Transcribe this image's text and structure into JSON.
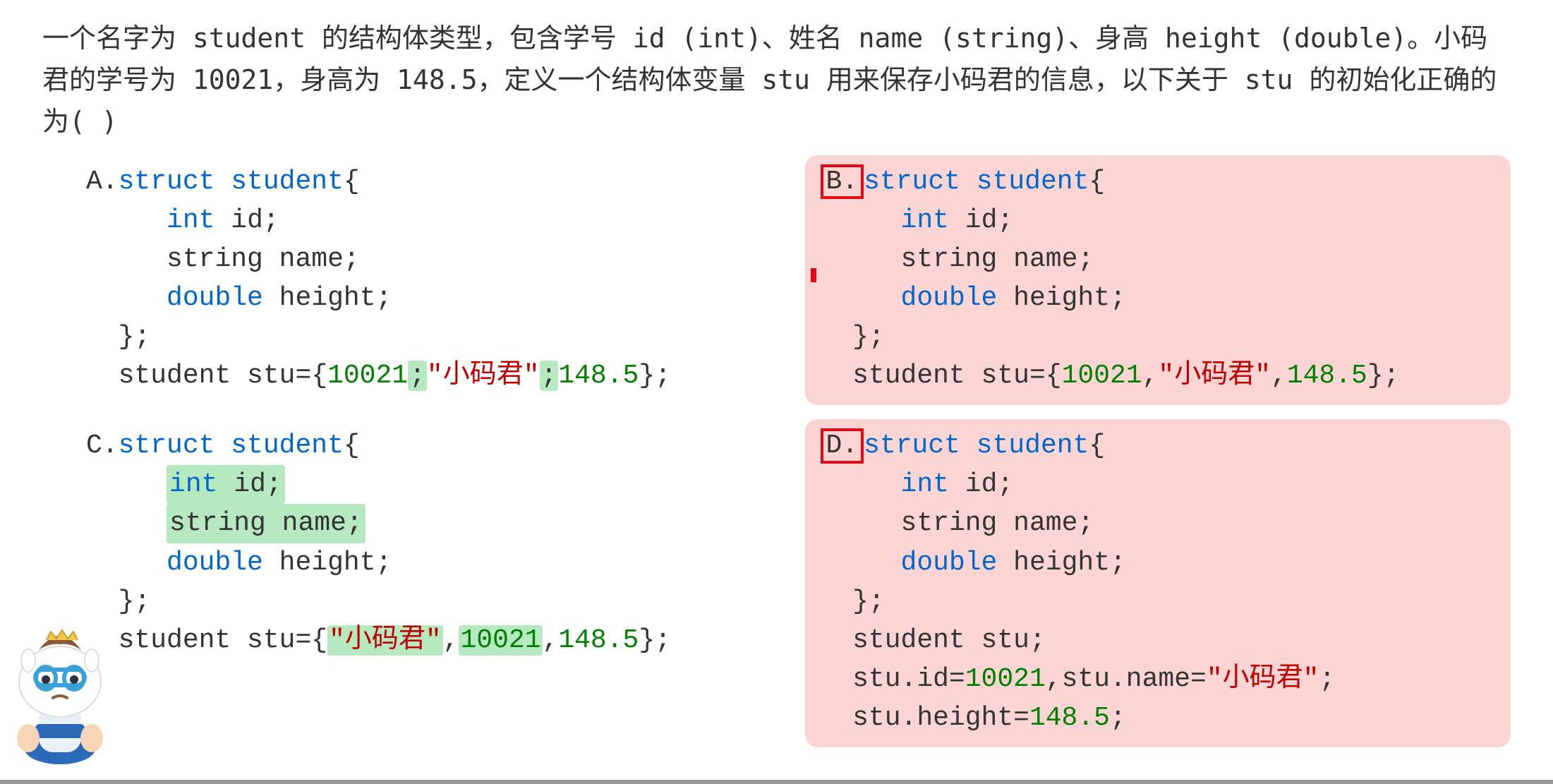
{
  "question": {
    "stem": "一个名字为 student 的结构体类型，包含学号 id (int)、姓名 name (string)、身高 height (double)。小码君的学号为 10021，身高为 148.5，定义一个结构体变量 stu 用来保存小码君的信息，以下关于 stu 的初始化正确的为(   )"
  },
  "options": {
    "A": {
      "label": "A.",
      "struct_kw": "struct",
      "struct_name": "student",
      "brace_open": "{",
      "line_int": "int",
      "id_name": "id;",
      "line_string": "string name;",
      "line_double": "double",
      "height_name": "height;",
      "brace_close": "};",
      "init_prefix": "student stu={",
      "init_num1": "10021",
      "init_sep1": ";",
      "init_str": "\"小码君\"",
      "init_sep2": ";",
      "init_num2": "148.5",
      "init_suffix": "};"
    },
    "B": {
      "label": "B.",
      "struct_kw": "struct",
      "struct_name": "student",
      "brace_open": "{",
      "line_int": "int",
      "id_name": "id;",
      "line_string": "string name;",
      "line_double": "double",
      "height_name": "height;",
      "brace_close": "};",
      "init_prefix": "student stu={",
      "init_num1": "10021",
      "init_sep1": ",",
      "init_str": "\"小码君\"",
      "init_sep2": ",",
      "init_num2": "148.5",
      "init_suffix": "};"
    },
    "C": {
      "label": "C.",
      "struct_kw": "struct",
      "struct_name": "student",
      "brace_open": "{",
      "line_int": "int",
      "id_name": "id;",
      "line_string_full": "string name;",
      "line_double": "double",
      "height_name": "height;",
      "brace_close": "};",
      "init_prefix": "student stu={",
      "init_str": "\"小码君\"",
      "init_sep1": ",",
      "init_num1": "10021",
      "init_sep2": ",",
      "init_num2": "148.5",
      "init_suffix": "};"
    },
    "D": {
      "label": "D.",
      "struct_kw": "struct",
      "struct_name": "student",
      "brace_open": "{",
      "line_int": "int",
      "id_name": "id;",
      "line_string": "string name;",
      "line_double": "double",
      "height_name": "height;",
      "brace_close": "};",
      "stmt1": "student stu;",
      "stmt2a": "stu.id=",
      "stmt2_num": "10021",
      "stmt2b": ",stu.name=",
      "stmt2_str": "\"小码君\"",
      "stmt2c": ";",
      "stmt3a": "stu.height=",
      "stmt3_num": "148.5",
      "stmt3b": ";"
    }
  }
}
